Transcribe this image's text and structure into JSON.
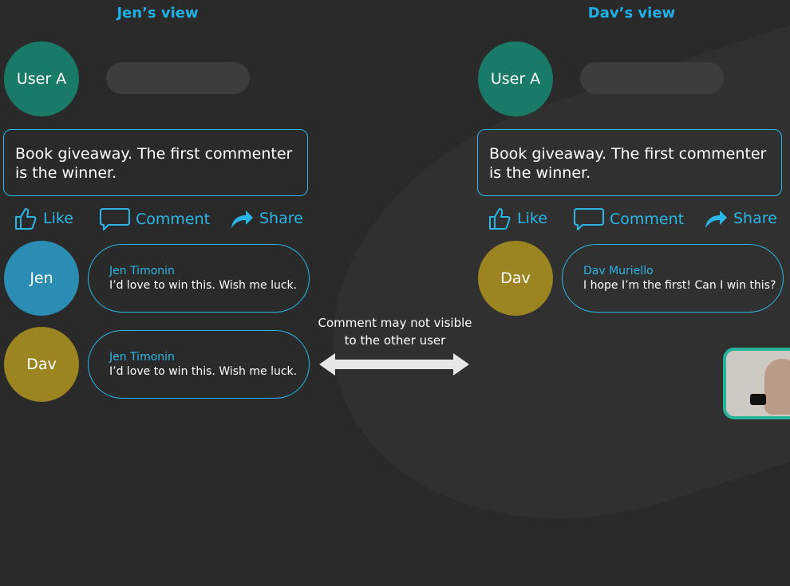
{
  "views": [
    {
      "title": "Jen’s view",
      "post_author": "User A",
      "post_text": "Book giveaway. The first commenter is the winner.",
      "actions": {
        "like": "Like",
        "comment": "Comment",
        "share": "Share"
      },
      "comments": [
        {
          "avatar_label": "Jen",
          "name": "Jen Timonin",
          "text": "I’d love to win this. Wish me luck."
        },
        {
          "avatar_label": "Dav",
          "name": "Jen Timonin",
          "text": "I’d love to win this. Wish me luck."
        }
      ]
    },
    {
      "title": "Dav’s view",
      "post_author": "User A",
      "post_text": "Book giveaway. The first commenter is the winner.",
      "actions": {
        "like": "Like",
        "comment": "Comment",
        "share": "Share"
      },
      "comments": [
        {
          "avatar_label": "Dav",
          "name": "Dav Muriello",
          "text": "I hope I’m the first! Can I win this?"
        }
      ]
    }
  ],
  "note": {
    "line1": "Comment may not visible",
    "line2": "to the other user"
  },
  "colors": {
    "accent": "#2ab6e6",
    "user_a": "#1a7a68",
    "jen": "#2b8db3",
    "dav": "#9c8520",
    "background": "#2a2a2a"
  },
  "icons": [
    "thumbs-up-icon",
    "comment-bubble-icon",
    "share-arrow-icon",
    "double-arrow-icon",
    "youtube-icon"
  ]
}
